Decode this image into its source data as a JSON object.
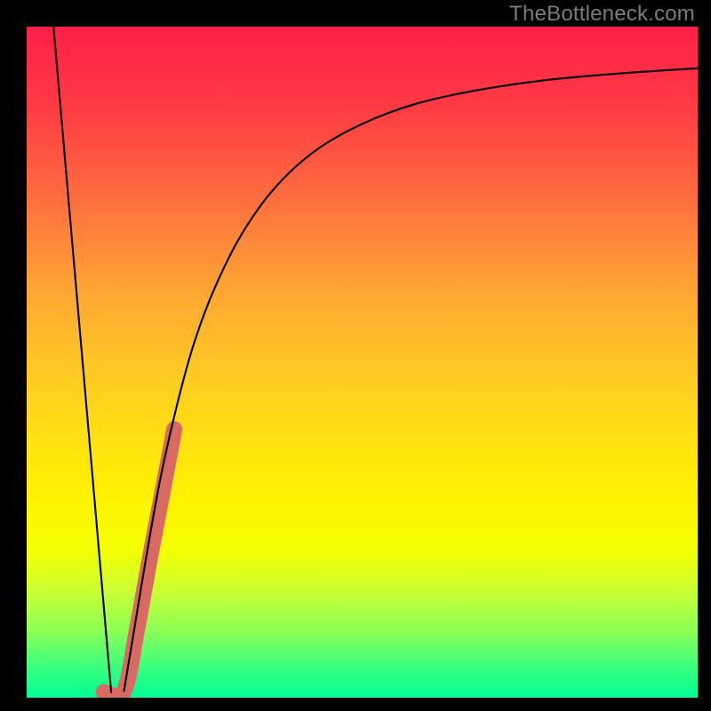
{
  "watermark": {
    "text": "TheBottleneck.com"
  },
  "gradient": {
    "stops": [
      {
        "pct": 0,
        "color": "#ff1f47"
      },
      {
        "pct": 12,
        "color": "#ff3b45"
      },
      {
        "pct": 25,
        "color": "#ff6b3f"
      },
      {
        "pct": 40,
        "color": "#ffa833"
      },
      {
        "pct": 55,
        "color": "#ffd21f"
      },
      {
        "pct": 70,
        "color": "#fff200"
      },
      {
        "pct": 78,
        "color": "#f4ff00"
      },
      {
        "pct": 84,
        "color": "#ccff33"
      },
      {
        "pct": 90,
        "color": "#8dff55"
      },
      {
        "pct": 95,
        "color": "#40ff7a"
      },
      {
        "pct": 100,
        "color": "#00ff99"
      }
    ]
  },
  "chart_data": {
    "type": "line",
    "title": "",
    "xlabel": "",
    "ylabel": "",
    "xlim": [
      0,
      100
    ],
    "ylim": [
      0,
      100
    ],
    "series": [
      {
        "name": "left-line",
        "style": "thin-black",
        "points": [
          {
            "x": 4.0,
            "y": 100.0
          },
          {
            "x": 12.6,
            "y": 0.8
          }
        ]
      },
      {
        "name": "right-curve",
        "style": "thin-black",
        "points": [
          {
            "x": 14.5,
            "y": 1.0
          },
          {
            "x": 16.0,
            "y": 10.0
          },
          {
            "x": 18.0,
            "y": 22.0
          },
          {
            "x": 20.0,
            "y": 33.0
          },
          {
            "x": 22.5,
            "y": 44.0
          },
          {
            "x": 25.0,
            "y": 53.0
          },
          {
            "x": 28.0,
            "y": 61.0
          },
          {
            "x": 32.0,
            "y": 69.0
          },
          {
            "x": 37.0,
            "y": 76.0
          },
          {
            "x": 43.0,
            "y": 81.5
          },
          {
            "x": 50.0,
            "y": 85.5
          },
          {
            "x": 58.0,
            "y": 88.5
          },
          {
            "x": 67.0,
            "y": 90.5
          },
          {
            "x": 77.0,
            "y": 92.0
          },
          {
            "x": 88.0,
            "y": 93.0
          },
          {
            "x": 100.0,
            "y": 93.8
          }
        ]
      },
      {
        "name": "highlight-band",
        "style": "thick-salmon",
        "points": [
          {
            "x": 11.5,
            "y": 0.8
          },
          {
            "x": 14.5,
            "y": 1.0
          },
          {
            "x": 16.5,
            "y": 10.5
          },
          {
            "x": 18.5,
            "y": 21.5
          },
          {
            "x": 20.5,
            "y": 32.0
          },
          {
            "x": 22.0,
            "y": 40.0
          }
        ]
      }
    ]
  }
}
